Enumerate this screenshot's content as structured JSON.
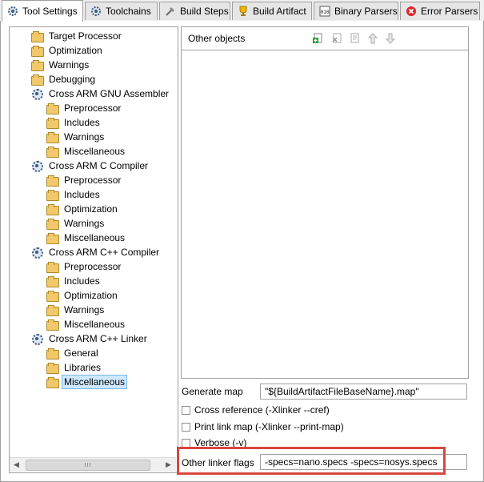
{
  "tabs": [
    {
      "label": "Tool Settings",
      "icon": "gear-icon",
      "active": true
    },
    {
      "label": "Toolchains",
      "icon": "toolchain-icon",
      "active": false
    },
    {
      "label": "Build Steps",
      "icon": "build-steps-icon",
      "active": false
    },
    {
      "label": "Build Artifact",
      "icon": "trophy-icon",
      "active": false
    },
    {
      "label": "Binary Parsers",
      "icon": "binary-icon",
      "active": false
    },
    {
      "label": "Error Parsers",
      "icon": "error-icon",
      "active": false
    }
  ],
  "tree": [
    {
      "label": "Target Processor",
      "level": 1,
      "icon": "folder-icon"
    },
    {
      "label": "Optimization",
      "level": 1,
      "icon": "folder-icon"
    },
    {
      "label": "Warnings",
      "level": 1,
      "icon": "folder-icon"
    },
    {
      "label": "Debugging",
      "level": 1,
      "icon": "folder-icon"
    },
    {
      "label": "Cross ARM GNU Assembler",
      "level": 1,
      "icon": "tool-icon"
    },
    {
      "label": "Preprocessor",
      "level": 2,
      "icon": "folder-icon"
    },
    {
      "label": "Includes",
      "level": 2,
      "icon": "folder-icon"
    },
    {
      "label": "Warnings",
      "level": 2,
      "icon": "folder-icon"
    },
    {
      "label": "Miscellaneous",
      "level": 2,
      "icon": "folder-icon"
    },
    {
      "label": "Cross ARM C Compiler",
      "level": 1,
      "icon": "tool-icon"
    },
    {
      "label": "Preprocessor",
      "level": 2,
      "icon": "folder-icon"
    },
    {
      "label": "Includes",
      "level": 2,
      "icon": "folder-icon"
    },
    {
      "label": "Optimization",
      "level": 2,
      "icon": "folder-icon"
    },
    {
      "label": "Warnings",
      "level": 2,
      "icon": "folder-icon"
    },
    {
      "label": "Miscellaneous",
      "level": 2,
      "icon": "folder-icon"
    },
    {
      "label": "Cross ARM C++ Compiler",
      "level": 1,
      "icon": "tool-icon"
    },
    {
      "label": "Preprocessor",
      "level": 2,
      "icon": "folder-icon"
    },
    {
      "label": "Includes",
      "level": 2,
      "icon": "folder-icon"
    },
    {
      "label": "Optimization",
      "level": 2,
      "icon": "folder-icon"
    },
    {
      "label": "Warnings",
      "level": 2,
      "icon": "folder-icon"
    },
    {
      "label": "Miscellaneous",
      "level": 2,
      "icon": "folder-icon"
    },
    {
      "label": "Cross ARM C++ Linker",
      "level": 1,
      "icon": "tool-icon"
    },
    {
      "label": "General",
      "level": 2,
      "icon": "folder-icon"
    },
    {
      "label": "Libraries",
      "level": 2,
      "icon": "folder-icon"
    },
    {
      "label": "Miscellaneous",
      "level": 2,
      "icon": "folder-icon",
      "selected": true
    }
  ],
  "scrollbar": {
    "grip": "III"
  },
  "other_objects": {
    "title": "Other objects",
    "toolbar_icons": [
      "add-icon",
      "delete-icon",
      "edit-icon",
      "move-up-icon",
      "move-down-icon"
    ]
  },
  "generate_map": {
    "label": "Generate map",
    "value": "\"${BuildArtifactFileBaseName}.map\""
  },
  "checkboxes": [
    {
      "label": "Cross reference (-Xlinker --cref)",
      "checked": false
    },
    {
      "label": "Print link map (-Xlinker --print-map)",
      "checked": false
    },
    {
      "label": "Verbose (-v)",
      "checked": false
    }
  ],
  "other_linker_flags": {
    "label": "Other linker flags",
    "value": "-specs=nano.specs -specs=nosys.specs"
  },
  "colors": {
    "highlight": "#d9463d",
    "selection": "#cde8ff"
  }
}
